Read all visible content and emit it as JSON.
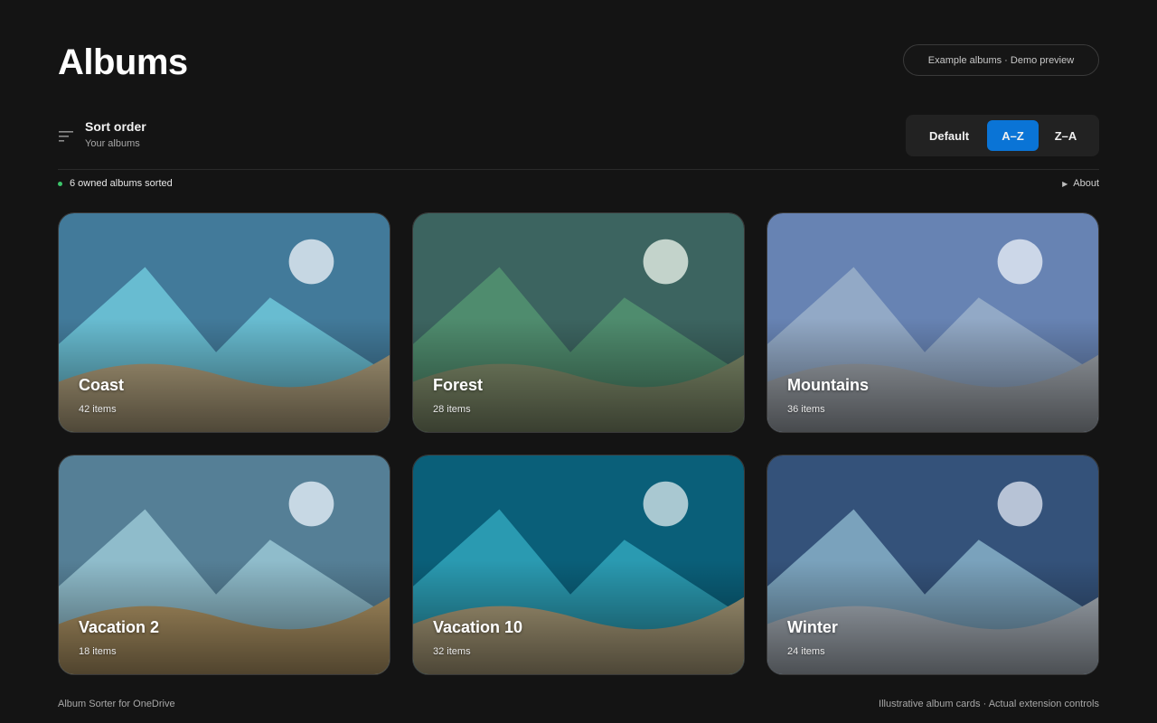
{
  "header": {
    "title": "Albums",
    "badge": "Example albums · Demo preview"
  },
  "sort": {
    "icon": "sort-lines-icon",
    "title": "Sort order",
    "subtitle": "Your albums",
    "options": [
      {
        "label": "Default",
        "selected": false
      },
      {
        "label": "A–Z",
        "selected": true
      },
      {
        "label": "Z–A",
        "selected": false
      }
    ],
    "active_color": "#0a74d6"
  },
  "status": {
    "text": "6 owned albums sorted",
    "dot_color": "#3cc46a",
    "about_label": "About",
    "about_icon": "play-triangle-icon"
  },
  "albums": [
    {
      "name": "Coast",
      "count": "42 items",
      "sky": "#427a9a",
      "mount": "#68bcd1",
      "ground": "#b0a07d",
      "sun": "#c6d7e3"
    },
    {
      "name": "Forest",
      "count": "28 items",
      "sky": "#3c6460",
      "mount": "#4f8c6e",
      "ground": "#7f8b6a",
      "sun": "#c3d3cb"
    },
    {
      "name": "Mountains",
      "count": "36 items",
      "sky": "#6783b3",
      "mount": "#92a9c6",
      "ground": "#9ea4ab",
      "sun": "#ccd7e8"
    },
    {
      "name": "Vacation 2",
      "count": "18 items",
      "sky": "#557f96",
      "mount": "#8fbccb",
      "ground": "#b29766",
      "sun": "#c7d8e4"
    },
    {
      "name": "Vacation 10",
      "count": "32 items",
      "sky": "#0a5f79",
      "mount": "#2a9ab1",
      "ground": "#ab9d7a",
      "sun": "#a9c8d1"
    },
    {
      "name": "Winter",
      "count": "24 items",
      "sky": "#34527a",
      "mount": "#7aa2bc",
      "ground": "#a8b0b9",
      "sun": "#b7c3d6"
    }
  ],
  "footer": {
    "left": "Album Sorter for OneDrive",
    "right": "Illustrative album cards · Actual extension controls"
  }
}
